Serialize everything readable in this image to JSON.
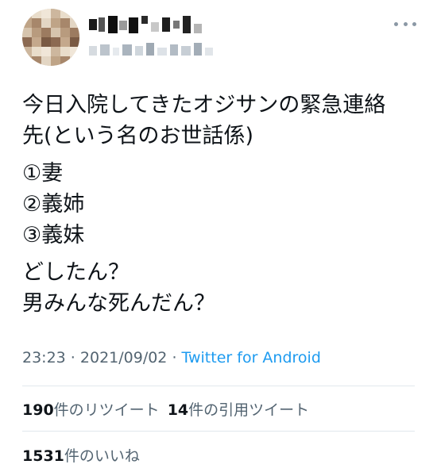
{
  "tweet": {
    "paragraphs": [
      [
        "今日入院してきたオジサンの緊急連絡",
        "先(という名のお世話係)"
      ],
      [
        "①妻",
        "②義姉",
        "③義妹"
      ],
      [
        "どしたん？",
        "男みんな死んだん？"
      ]
    ],
    "time": "23:23",
    "separator": " · ",
    "date": "2021/09/02",
    "source": "Twitter for Android"
  },
  "stats": {
    "retweets_count": "190",
    "retweets_label": "件のリツイート",
    "quotes_count": "14",
    "quotes_label": "件の引用ツイート",
    "likes_count": "1531",
    "likes_label": "件のいいね"
  },
  "icons": {
    "more": "more-horizontal-icon"
  },
  "colors": {
    "text": "#0f1419",
    "secondary": "#536471",
    "link": "#1d9bf0",
    "divider": "#e1e8ed"
  }
}
